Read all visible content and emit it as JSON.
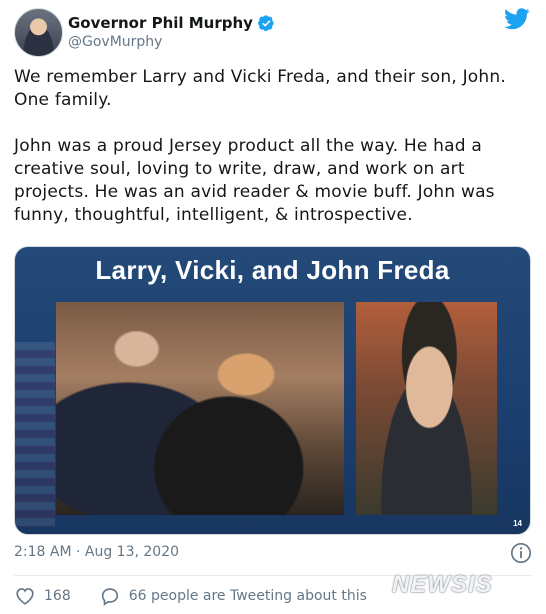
{
  "tweet": {
    "author": {
      "display_name": "Governor Phil Murphy",
      "handle": "@GovMurphy",
      "verified": true
    },
    "paragraphs": [
      "We remember Larry and Vicki Freda, and their son, John. One family.",
      "John was a proud Jersey product all the way. He had a creative soul, loving to write, draw, and work on art projects. He was an avid reader & movie buff. John was funny, thoughtful, intelligent, & introspective."
    ],
    "media": {
      "slide_title": "Larry, Vicki, and John Freda",
      "slide_number": "14"
    },
    "timestamp": "2:18 AM · Aug 13, 2020",
    "likes": "168",
    "tweeting_about": "66 people are Tweeting about this"
  },
  "watermark": "NEWSIS",
  "colors": {
    "twitter_blue": "#1da1f2",
    "text_primary": "#14171a",
    "text_secondary": "#657786",
    "slide_background": "#1f4574"
  },
  "icons": {
    "brand": "twitter-bird-icon",
    "verified": "verified-badge-icon",
    "info": "info-icon",
    "like": "heart-icon",
    "reply": "reply-icon"
  }
}
